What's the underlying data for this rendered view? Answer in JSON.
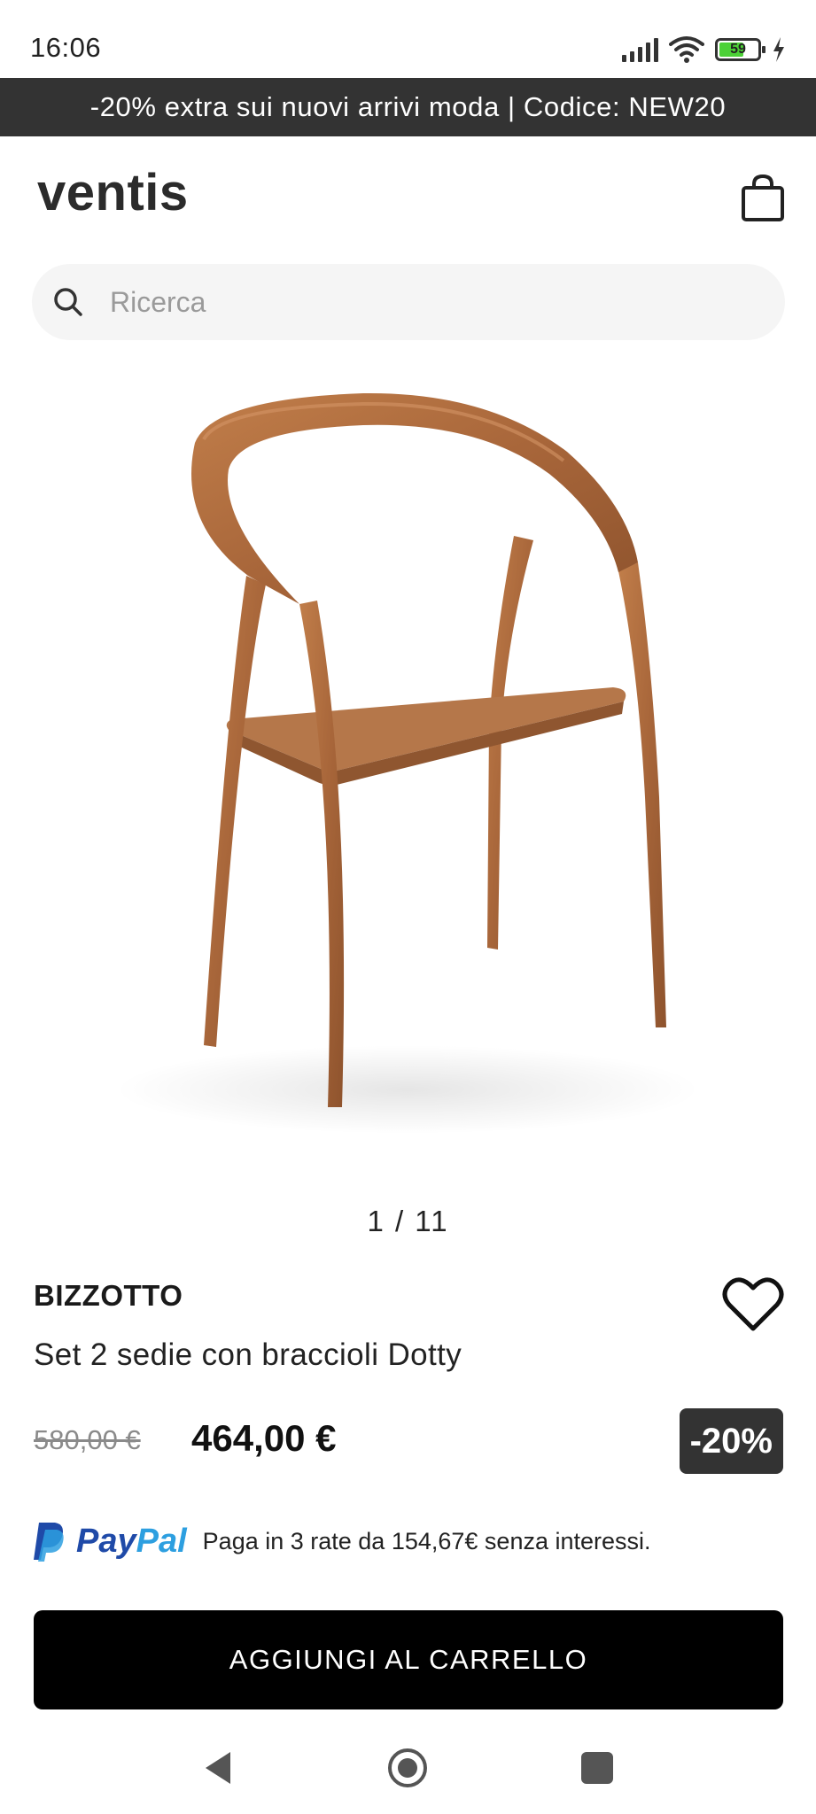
{
  "status_bar": {
    "time": "16:06",
    "battery_level": "59",
    "battery_fraction": 0.59,
    "icons": [
      "signal-icon",
      "wifi-icon",
      "battery-icon",
      "charging-icon"
    ]
  },
  "promo_banner": {
    "text": "-20% extra sui nuovi arrivi moda | Codice: NEW20"
  },
  "header": {
    "logo": "ventis",
    "cart_icon": "shopping-bag-icon"
  },
  "search": {
    "placeholder": "Ricerca",
    "value": ""
  },
  "gallery": {
    "pager": "1 / 11",
    "image_subject": "wooden-chair-image"
  },
  "product": {
    "brand": "BIZZOTTO",
    "name": "Set 2 sedie con braccioli Dotty",
    "old_price": "580,00 €",
    "price": "464,00 €",
    "discount": "-20%",
    "wishlist_icon": "heart-icon"
  },
  "paypal": {
    "word_pay": "Pay",
    "word_pal": "Pal",
    "text": "Paga in 3 rate da 154,67€ senza interessi."
  },
  "cta": {
    "add_to_cart": "AGGIUNGI AL CARRELLO"
  },
  "colors": {
    "banner_bg": "#333333",
    "button_bg": "#000000",
    "paypal_dark": "#1f4aa8",
    "paypal_light": "#2d9fe0",
    "wood": "#b0713f"
  }
}
